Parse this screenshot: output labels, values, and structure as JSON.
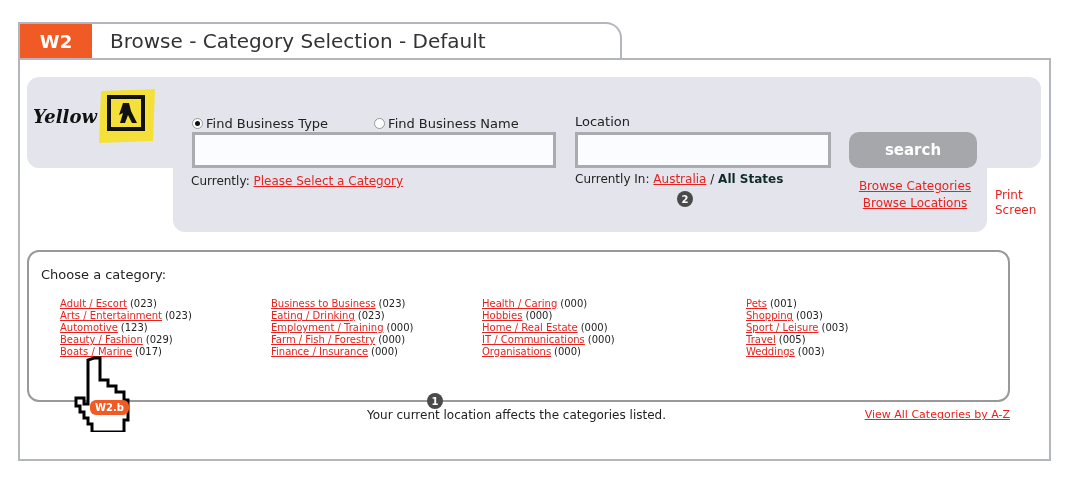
{
  "header": {
    "code": "W2",
    "title": "Browse - Category Selection - Default"
  },
  "logo": {
    "text": "Yellow"
  },
  "search": {
    "radios": [
      {
        "label": "Find Business Type",
        "selected": true
      },
      {
        "label": "Find Business Name",
        "selected": false
      }
    ],
    "currently_label": "Currently:",
    "currently_link": "Please Select a Category",
    "location_label": "Location",
    "location_currently_label": "Currently In:",
    "location_link": "Australia",
    "location_separator": "/",
    "location_state": "All States",
    "button": "search",
    "links": [
      "Browse Categories",
      "Browse Locations"
    ],
    "print": "Print Screen"
  },
  "categories": {
    "heading": "Choose a category:",
    "columns": [
      [
        {
          "name": "Adult / Escort",
          "count": "(023)"
        },
        {
          "name": "Arts / Entertainment",
          "count": "(023)"
        },
        {
          "name": "Automotive",
          "count": "(123)"
        },
        {
          "name": "Beauty / Fashion",
          "count": "(029)"
        },
        {
          "name": "Boats / Marine",
          "count": "(017)"
        }
      ],
      [
        {
          "name": "Business to Business",
          "count": "(023)"
        },
        {
          "name": "Eating / Drinking",
          "count": "(023)"
        },
        {
          "name": "Employment / Training",
          "count": "(000)"
        },
        {
          "name": "Farm / Fish /  Forestry",
          "count": "(000)"
        },
        {
          "name": "Finance / Insurance",
          "count": "(000)"
        }
      ],
      [
        {
          "name": "Health / Caring",
          "count": "(000)"
        },
        {
          "name": "Hobbies",
          "count": "(000)"
        },
        {
          "name": "Home / Real Estate",
          "count": "(000)"
        },
        {
          "name": "IT / Communications",
          "count": "(000)"
        },
        {
          "name": "Organisations",
          "count": "(000)"
        }
      ],
      [
        {
          "name": "Pets",
          "count": "(001)"
        },
        {
          "name": "Shopping",
          "count": "(003)"
        },
        {
          "name": "Sport / Leisure",
          "count": "(003)"
        },
        {
          "name": "Travel",
          "count": "(005)"
        },
        {
          "name": "Weddings",
          "count": "(003)"
        }
      ]
    ]
  },
  "note": "Your current location affects the categories listed.",
  "view_all": "View All Categories by A-Z",
  "markers": {
    "location": "2",
    "categories": "1",
    "cursor": "W2.b"
  }
}
